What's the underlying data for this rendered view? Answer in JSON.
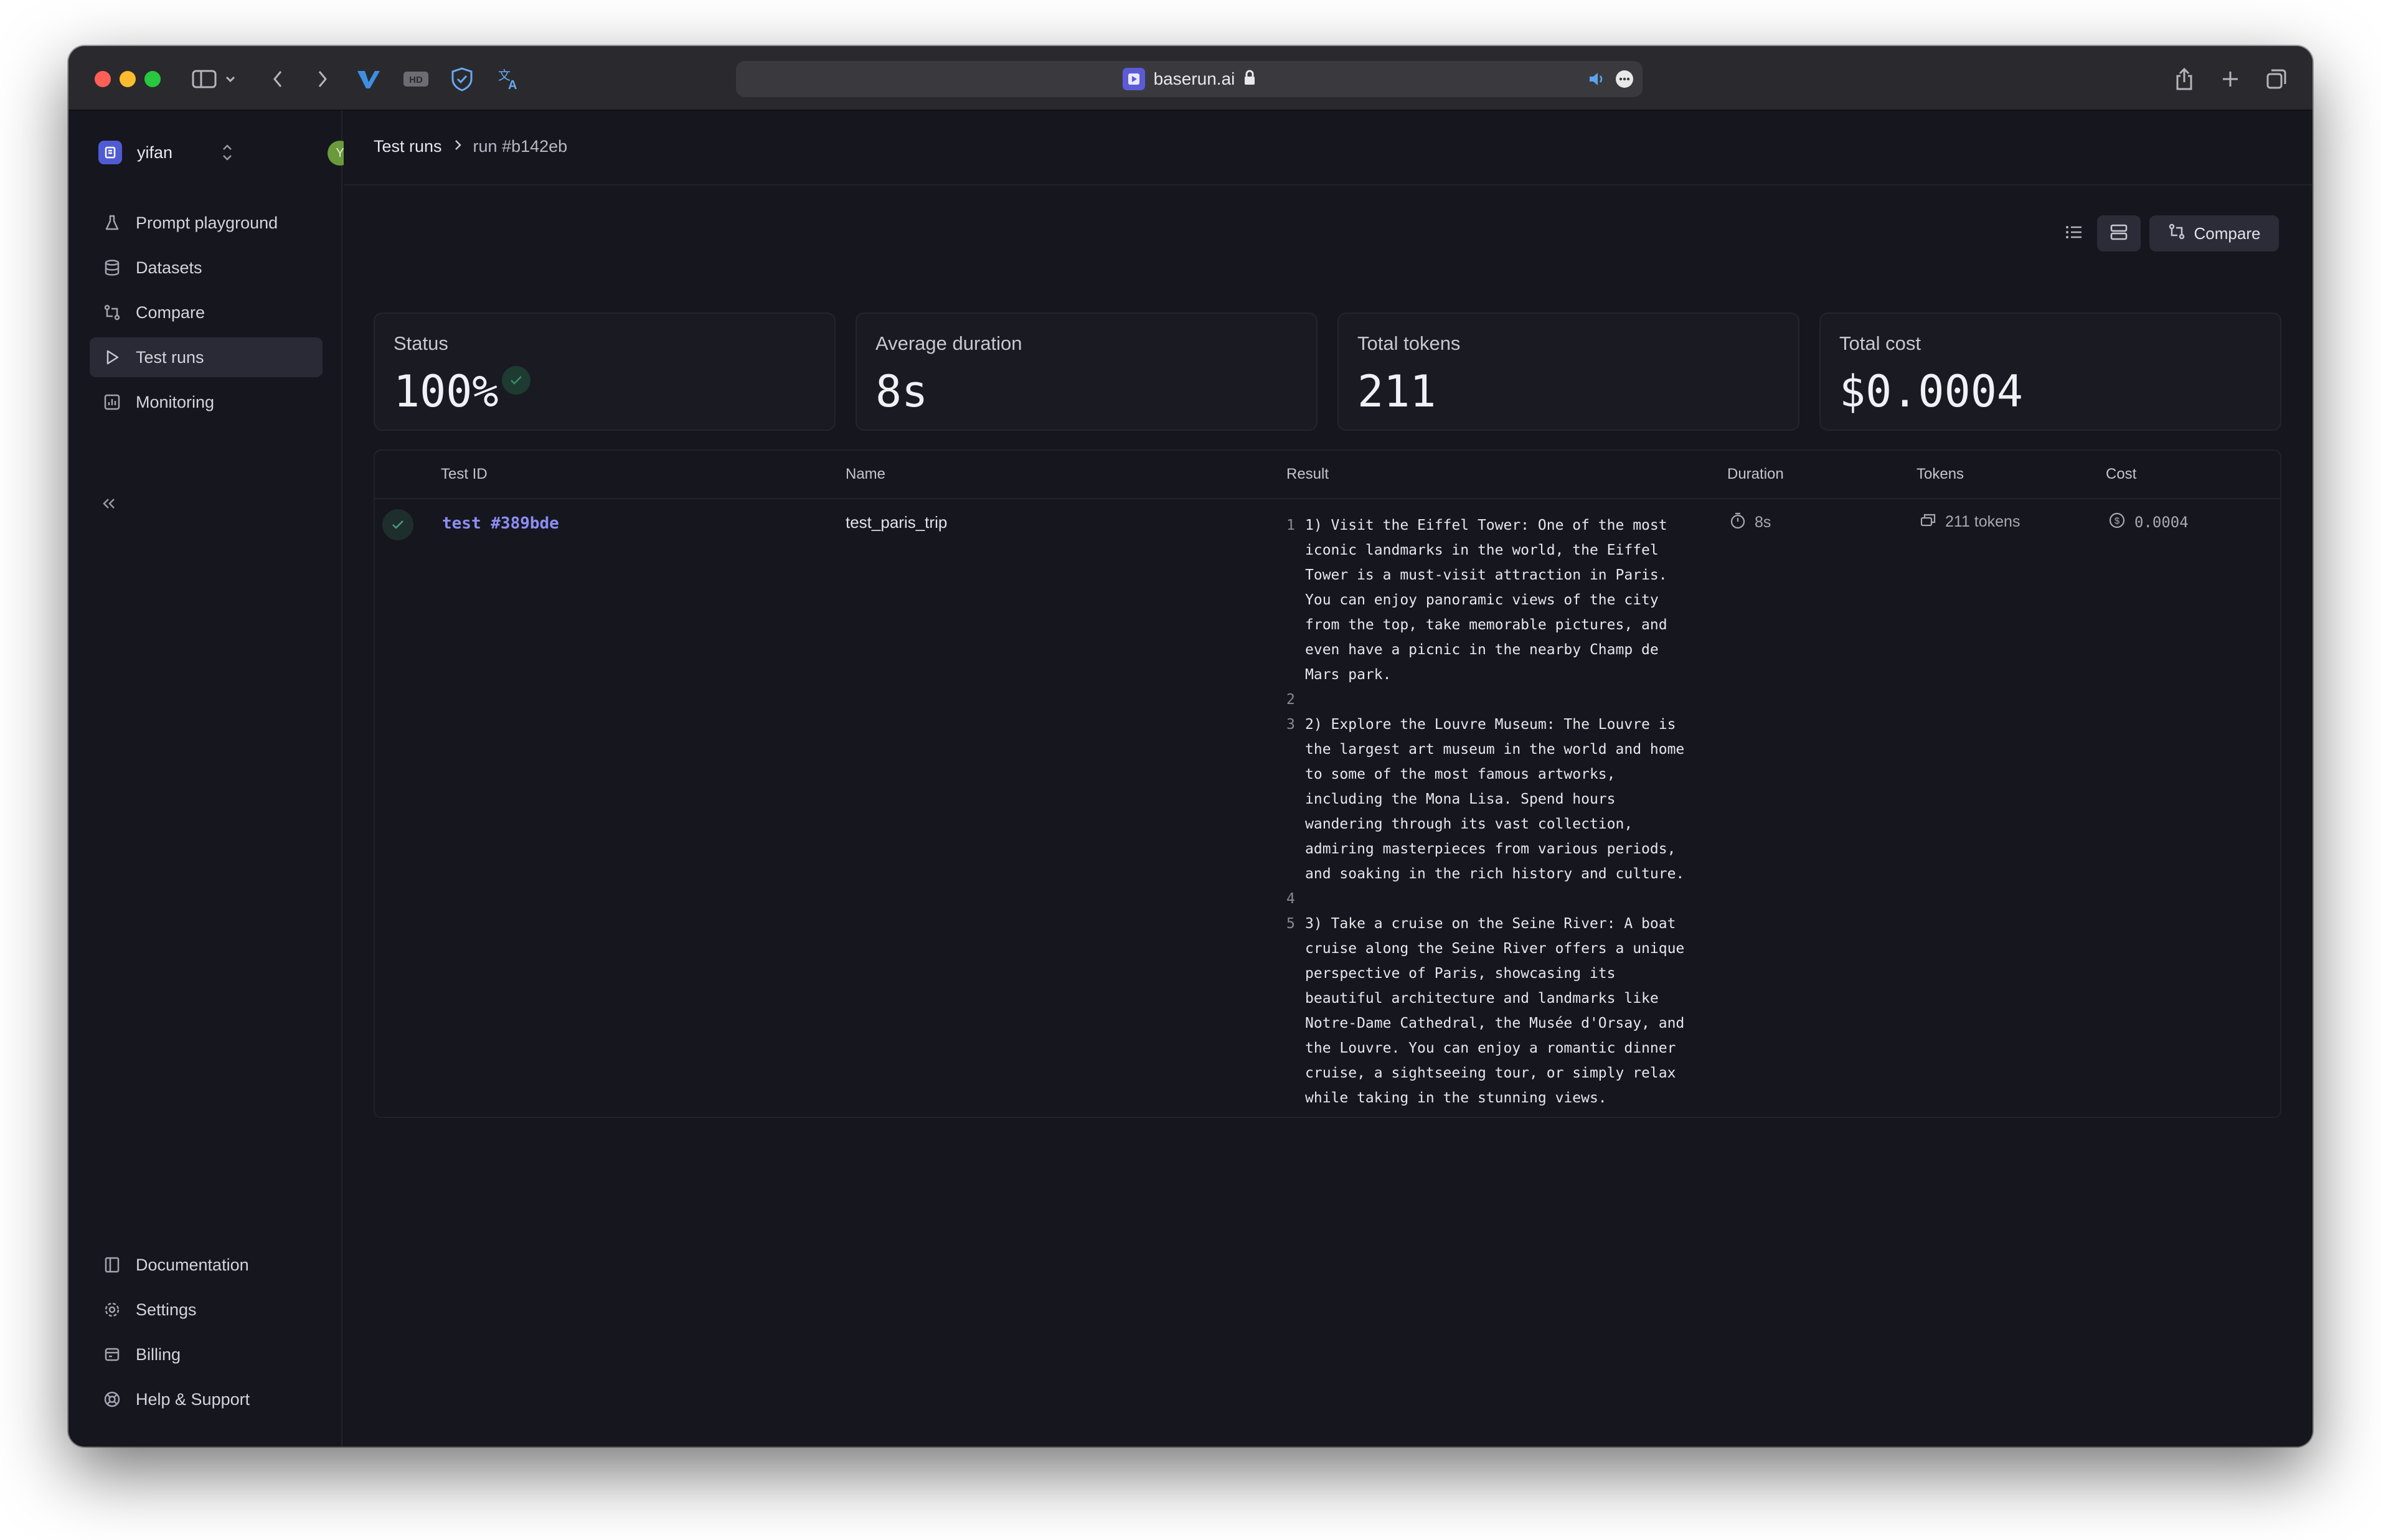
{
  "browser": {
    "url": "baserun.ai"
  },
  "workspace": {
    "name": "yifan",
    "avatar_initial": "Y"
  },
  "sidebar": {
    "items": [
      {
        "label": "Prompt playground",
        "icon": "flask-icon"
      },
      {
        "label": "Datasets",
        "icon": "database-icon"
      },
      {
        "label": "Compare",
        "icon": "git-compare-icon"
      },
      {
        "label": "Test runs",
        "icon": "play-icon",
        "active": true
      },
      {
        "label": "Monitoring",
        "icon": "chart-icon"
      }
    ],
    "collapse_label": "«",
    "bottom_items": [
      {
        "label": "Documentation",
        "icon": "book-icon"
      },
      {
        "label": "Settings",
        "icon": "gear-icon"
      },
      {
        "label": "Billing",
        "icon": "billing-icon"
      },
      {
        "label": "Help & Support",
        "icon": "lifebuoy-icon"
      }
    ]
  },
  "breadcrumb": {
    "root": "Test runs",
    "current": "run #b142eb"
  },
  "toolbar": {
    "compare_label": "Compare"
  },
  "stats": [
    {
      "label": "Status",
      "value": "100%"
    },
    {
      "label": "Average duration",
      "value": "8s"
    },
    {
      "label": "Total tokens",
      "value": "211"
    },
    {
      "label": "Total cost",
      "value": "$0.0004"
    }
  ],
  "table": {
    "columns": [
      "Test ID",
      "Name",
      "Result",
      "Duration",
      "Tokens",
      "Cost"
    ],
    "rows": [
      {
        "test_id": "test #389bde",
        "name": "test_paris_trip",
        "result_lines": [
          {
            "n": "1",
            "text": "1) Visit the Eiffel Tower: One of the most iconic landmarks in the world, the Eiffel Tower is a must-visit attraction in Paris. You can enjoy panoramic views of the city from the top, take memorable pictures, and even have a picnic in the nearby Champ de Mars park."
          },
          {
            "n": "2",
            "text": ""
          },
          {
            "n": "3",
            "text": "2) Explore the Louvre Museum: The Louvre is the largest art museum in the world and home to some of the most famous artworks, including the Mona Lisa. Spend hours wandering through its vast collection, admiring masterpieces from various periods, and soaking in the rich history and culture."
          },
          {
            "n": "4",
            "text": ""
          },
          {
            "n": "5",
            "text": "3) Take a cruise on the Seine River: A boat cruise along the Seine River offers a unique perspective of Paris, showcasing its beautiful architecture and landmarks like Notre-Dame Cathedral, the Musée d'Orsay, and the Louvre. You can enjoy a romantic dinner cruise, a sightseeing tour, or simply relax while taking in the stunning views."
          }
        ],
        "duration": "8s",
        "tokens": "211 tokens",
        "cost": "0.0004"
      }
    ]
  }
}
